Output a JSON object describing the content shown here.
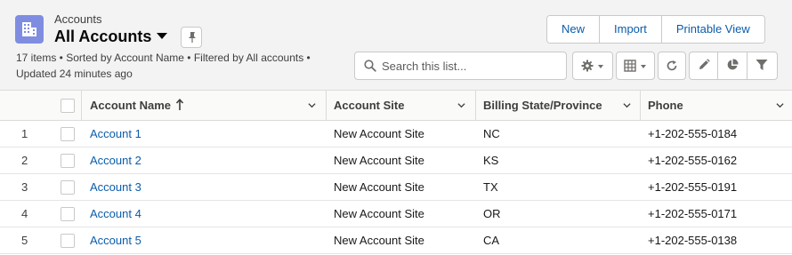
{
  "header": {
    "object_label": "Accounts",
    "list_title": "All Accounts",
    "meta_line1": "17 items • Sorted by Account Name • Filtered by All accounts •",
    "meta_line2": "Updated 24 minutes ago",
    "app_icon": "accounts-building-icon",
    "icon_color": "#7f8de1"
  },
  "actions": {
    "new": "New",
    "import": "Import",
    "printable_view": "Printable View"
  },
  "search": {
    "placeholder": "Search this list..."
  },
  "toolbar": {
    "icons": [
      "gear-icon",
      "table-icon",
      "refresh-icon",
      "pencil-icon",
      "pie-chart-icon",
      "filter-icon"
    ]
  },
  "table": {
    "columns": [
      "Account Name",
      "Account Site",
      "Billing State/Province",
      "Phone"
    ],
    "sorted_column": "Account Name",
    "sort_direction": "ascending",
    "rows": [
      {
        "num": "1",
        "name": "Account 1",
        "site": "New Account Site",
        "state": "NC",
        "phone": "+1-202-555-0184"
      },
      {
        "num": "2",
        "name": "Account 2",
        "site": "New Account Site",
        "state": "KS",
        "phone": "+1-202-555-0162"
      },
      {
        "num": "3",
        "name": "Account 3",
        "site": "New Account Site",
        "state": "TX",
        "phone": "+1-202-555-0191"
      },
      {
        "num": "4",
        "name": "Account 4",
        "site": "New Account Site",
        "state": "OR",
        "phone": "+1-202-555-0171"
      },
      {
        "num": "5",
        "name": "Account 5",
        "site": "New Account Site",
        "state": "CA",
        "phone": "+1-202-555-0138"
      }
    ]
  },
  "colors": {
    "link": "#0b5cab",
    "header_bg": "#f3f3f3",
    "border": "#c9c9c9"
  }
}
